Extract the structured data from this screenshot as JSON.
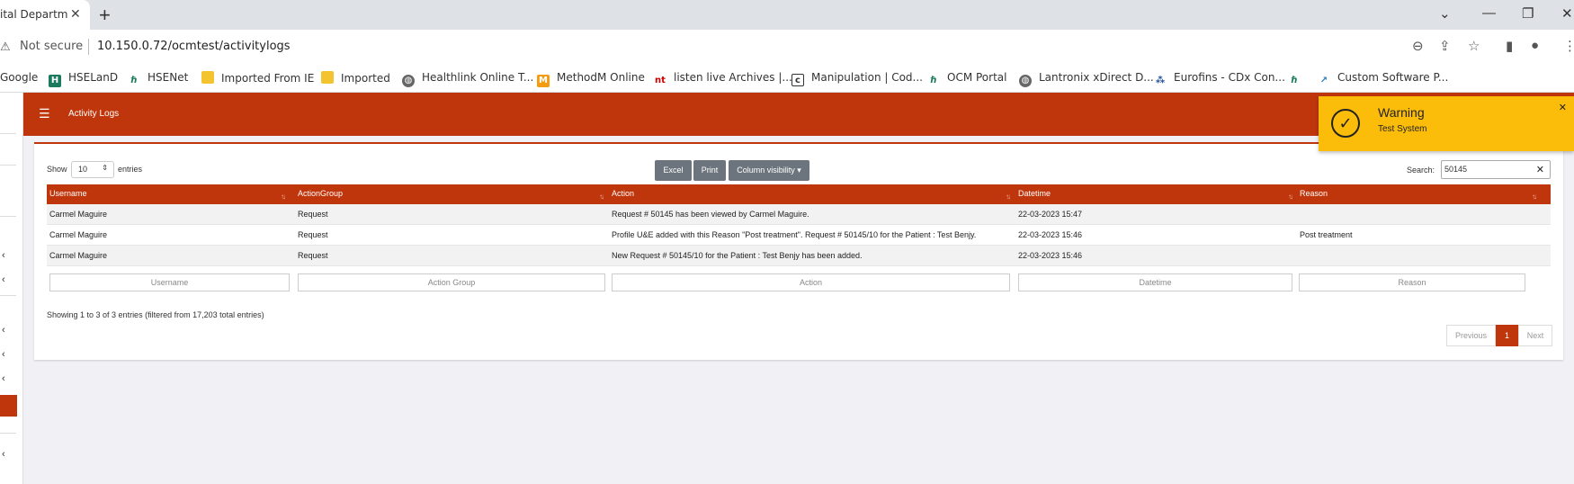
{
  "browser": {
    "tab_title": "ital Departm",
    "close_glyph": "✕",
    "newtab_glyph": "+",
    "window_controls": [
      "⌄",
      "—",
      "❐",
      "✕"
    ],
    "security_label": "Not secure",
    "url": "10.150.0.72/ocmtest/activitylogs"
  },
  "bookmarks": [
    {
      "label": "Google",
      "icon": "none"
    },
    {
      "label": "HSELanD",
      "icon": "hseland-icon",
      "color": "#1a7a5e"
    },
    {
      "label": "HSENet",
      "icon": "hse-icon",
      "color": "#1a7a5e"
    },
    {
      "label": "Imported From IE",
      "icon": "folder-icon",
      "color": "#f4c430"
    },
    {
      "label": "Imported",
      "icon": "folder-icon",
      "color": "#f4c430"
    },
    {
      "label": "Healthlink Online T...",
      "icon": "globe-icon",
      "color": "#555"
    },
    {
      "label": "MethodM Online",
      "icon": "methodm-icon",
      "color": "#f39c12"
    },
    {
      "label": "listen live Archives |...",
      "icon": "nt-icon",
      "color": "#c00"
    },
    {
      "label": "Manipulation | Cod...",
      "icon": "doc-icon",
      "color": "#333"
    },
    {
      "label": "OCM Portal",
      "icon": "ocm-icon",
      "color": "#1a7a5e"
    },
    {
      "label": "Lantronix xDirect D...",
      "icon": "globe-icon",
      "color": "#555"
    },
    {
      "label": "Eurofins - CDx Con...",
      "icon": "eurofins-icon",
      "color": "#1e4f9c"
    },
    {
      "label": "",
      "icon": "hse-icon",
      "color": "#1a7a5e"
    },
    {
      "label": "Custom Software P...",
      "icon": "custom-icon",
      "color": "#2a7ab8"
    }
  ],
  "app": {
    "page_title": "Activity Logs",
    "accent": "#bf360c"
  },
  "controls": {
    "show_label": "Show",
    "page_length": "10",
    "entries_label": "entries",
    "buttons": [
      "Excel",
      "Print",
      "Column visibility ▾"
    ],
    "search_label": "Search:",
    "search_value": "50145"
  },
  "table": {
    "columns": [
      "Username",
      "ActionGroup",
      "Action",
      "Datetime",
      "Reason"
    ],
    "rows": [
      [
        "Carmel Maguire",
        "Request",
        "Request # 50145 has been viewed by Carmel Maguire.",
        "22-03-2023 15:47",
        ""
      ],
      [
        "Carmel Maguire",
        "Request",
        "Profile U&E added with this Reason \"Post treatment\". Request # 50145/10 for the Patient : Test Benjy.",
        "22-03-2023 15:46",
        "Post treatment"
      ],
      [
        "Carmel Maguire",
        "Request",
        "New Request # 50145/10 for the Patient : Test Benjy has been added.",
        "22-03-2023 15:46",
        ""
      ]
    ],
    "filters": [
      "Username",
      "Action Group",
      "Action",
      "Datetime",
      "Reason"
    ]
  },
  "footer": {
    "info": "Showing 1 to 3 of 3 entries (filtered from 17,203 total entries)",
    "previous": "Previous",
    "page": "1",
    "next": "Next"
  },
  "toast": {
    "title": "Warning",
    "message": "Test System",
    "color": "#fbbd09"
  }
}
